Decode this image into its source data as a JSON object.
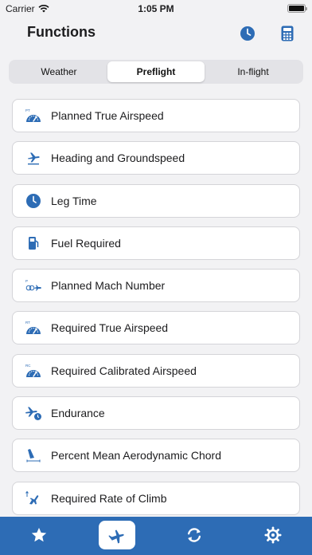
{
  "status": {
    "carrier": "Carrier",
    "time": "1:05 PM"
  },
  "header": {
    "title": "Functions",
    "history_icon": "clock-icon",
    "calculator_icon": "calculator-icon"
  },
  "segments": {
    "items": [
      "Weather",
      "Preflight",
      "In-flight"
    ],
    "selected": "Preflight"
  },
  "functions": [
    {
      "label": "Planned True Airspeed",
      "icon": "speedometer-icon",
      "icon_tag": "PT"
    },
    {
      "label": "Heading and Groundspeed",
      "icon": "airplane-icon"
    },
    {
      "label": "Leg Time",
      "icon": "clock-icon"
    },
    {
      "label": "Fuel Required",
      "icon": "fuel-pump-icon"
    },
    {
      "label": "Planned Mach Number",
      "icon": "mach-icon",
      "icon_tag": "P"
    },
    {
      "label": "Required True Airspeed",
      "icon": "speedometer-icon",
      "icon_tag": "RT"
    },
    {
      "label": "Required Calibrated Airspeed",
      "icon": "speedometer-icon",
      "icon_tag": "RC"
    },
    {
      "label": "Endurance",
      "icon": "airplane-clock-icon"
    },
    {
      "label": "Percent Mean Aerodynamic Chord",
      "icon": "wing-icon"
    },
    {
      "label": "Required Rate of Climb",
      "icon": "climb-icon"
    }
  ],
  "tabbar": {
    "items": [
      {
        "name": "favorites",
        "icon": "star-icon"
      },
      {
        "name": "functions",
        "icon": "airplane-icon"
      },
      {
        "name": "conversions",
        "icon": "refresh-icon"
      },
      {
        "name": "settings",
        "icon": "gear-icon"
      }
    ],
    "selected": "functions"
  },
  "colors": {
    "accent": "#2d6cb5",
    "background": "#f2f2f4",
    "card": "#ffffff"
  }
}
